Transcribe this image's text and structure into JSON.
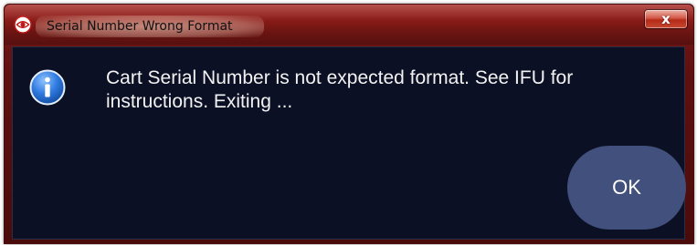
{
  "window": {
    "title": "Serial Number Wrong Format",
    "close_label": "x"
  },
  "dialog": {
    "message": "Cart Serial Number is not expected format.  See IFU for instructions. Exiting ...",
    "icon": "info-icon",
    "ok_label": "OK"
  },
  "colors": {
    "titlebar": "#8c1c18",
    "content_background": "#0c1024",
    "ok_button": "#41507d",
    "text": "#f2f2f2"
  }
}
